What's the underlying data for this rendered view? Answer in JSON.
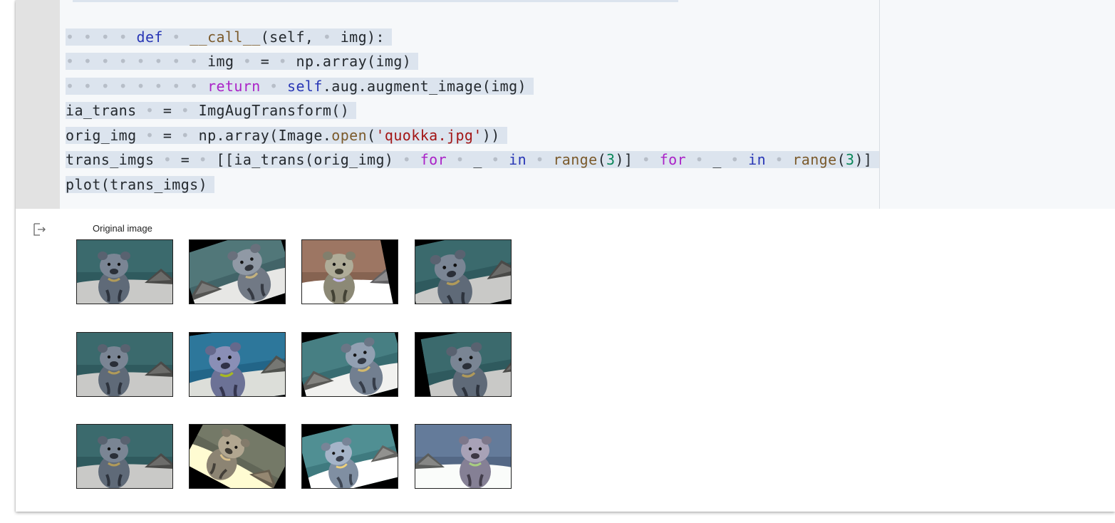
{
  "code": {
    "line_1": "",
    "line_2": {
      "indent": "• • • • ",
      "t1": "def",
      "s1": " • ",
      "t2": "__call__",
      "t3": "(self, ",
      "s2": "• ",
      "t4": "img):"
    },
    "line_3": {
      "indent": "• • • • • • • • ",
      "t1": "img",
      "s1": " • ",
      "t2": "=",
      "s2": " • ",
      "t3": "np.array(img)"
    },
    "line_4": {
      "indent": "• • • • • • • • ",
      "t1": "return",
      "s1": " • ",
      "t2": "self",
      "t3": ".aug.augment_image(img)"
    },
    "line_5": {
      "t1": "ia_trans",
      "s1": " • ",
      "t2": "=",
      "s2": " • ",
      "t3": "ImgAugTransform()"
    },
    "line_6": {
      "t1": "orig_img",
      "s1": " • ",
      "t2": "=",
      "s2": " • ",
      "t3": "np.array(Image.",
      "t4": "open",
      "t5": "(",
      "t6": "'quokka.jpg'",
      "t7": "))"
    },
    "line_7": {
      "t1": "trans_imgs",
      "s1": " • ",
      "t2": "=",
      "s2": " • ",
      "t3": "[[ia_trans(orig_img)",
      "s3": " • ",
      "t4": "for",
      "s4": " • ",
      "t5": "_",
      "s5": " • ",
      "t6": "in",
      "s6": " • ",
      "t7": "range",
      "t8": "(",
      "t9": "3",
      "t10": ")]",
      "s7": " • ",
      "t11": "for",
      "s8": " • ",
      "t12": "_",
      "s9": " • ",
      "t13": "in",
      "s10": " • ",
      "t14": "range",
      "t15": "(",
      "t16": "3",
      "t17": ")]"
    },
    "line_8": {
      "t1": "plot(trans_imgs)"
    }
  },
  "output": {
    "icon": "output-arrow-icon",
    "figure_title": "Original image",
    "thumbnail_rows": 3,
    "thumbnail_cols": 4
  },
  "colors": {
    "keyword": "#2836b5",
    "control_flow": "#aa22c7",
    "builtin_function": "#7b5a2b",
    "string": "#a31515",
    "number": "#098658",
    "selection": "#dce4ee"
  }
}
